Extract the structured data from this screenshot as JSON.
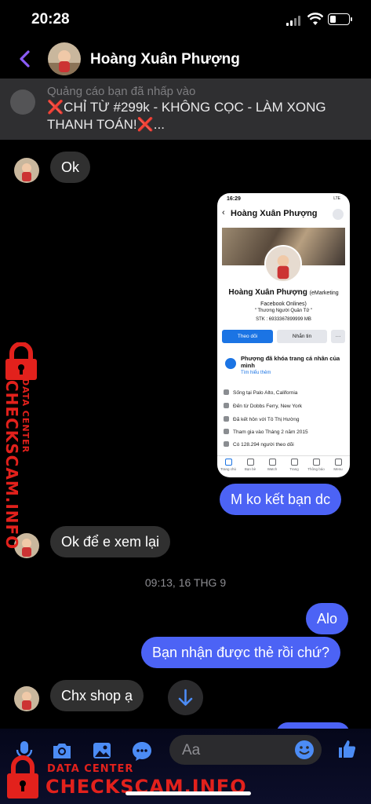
{
  "status_bar": {
    "time": "20:28",
    "battery_level": 0.35
  },
  "header": {
    "contact_name": "Hoàng Xuân Phượng"
  },
  "ad_banner": {
    "label": "Quảng cáo bạn đã nhấp vào",
    "text": "❌CHỈ TỪ #299k - KHÔNG CỌC - LÀM XONG THANH TOÁN!❌..."
  },
  "messages": {
    "m1": "Ok",
    "m2": "M ko kết bạn dc",
    "m3": "Ok để e xem lại",
    "timestamp": "09:13, 16 THG 9",
    "m4": "Alo",
    "m5": "Bạn nhận được thẻ rồi chứ?",
    "m6": "Chx shop ạ"
  },
  "shared_photo": {
    "time": "16:29",
    "network": "LTE",
    "name": "Hoàng Xuân Phượng",
    "profile_name": "Hoàng Xuân Phượng",
    "profile_suffix": "(eMarketing Facebook Onlines)",
    "motto": "\" Thương Người Quân Tử \"",
    "stk": "STK : 6933367899999 MB",
    "follow_label": "Theo dõi",
    "message_label": "Nhắn tin",
    "more_label": "···",
    "lock_title": "Phượng đã khóa trang cá nhân của mình",
    "lock_link": "Tìm hiểu thêm",
    "info": [
      "Sống tại Palo Alto, California",
      "Đến từ Dobbs Ferry, New York",
      "Đã kết hôn với Tô Thị Hường",
      "Tham gia vào Tháng 2 năm 2015",
      "Có 128.294 người theo dõi"
    ],
    "tabs": [
      "Trang chủ",
      "Bạn bè",
      "Watch",
      "Trang",
      "Thông báo",
      "Menu"
    ]
  },
  "composer": {
    "placeholder": "Aa"
  },
  "watermark": {
    "side_top": "DATA CENTER",
    "side_main": "CHECKSCAM.INFO",
    "bottom_top": "DATA CENTER",
    "bottom_main": "CHECKSCAM.INFO"
  },
  "colors": {
    "accent": "#4c63f5",
    "back_arrow": "#8b5cf6",
    "watermark": "#e2211c"
  }
}
